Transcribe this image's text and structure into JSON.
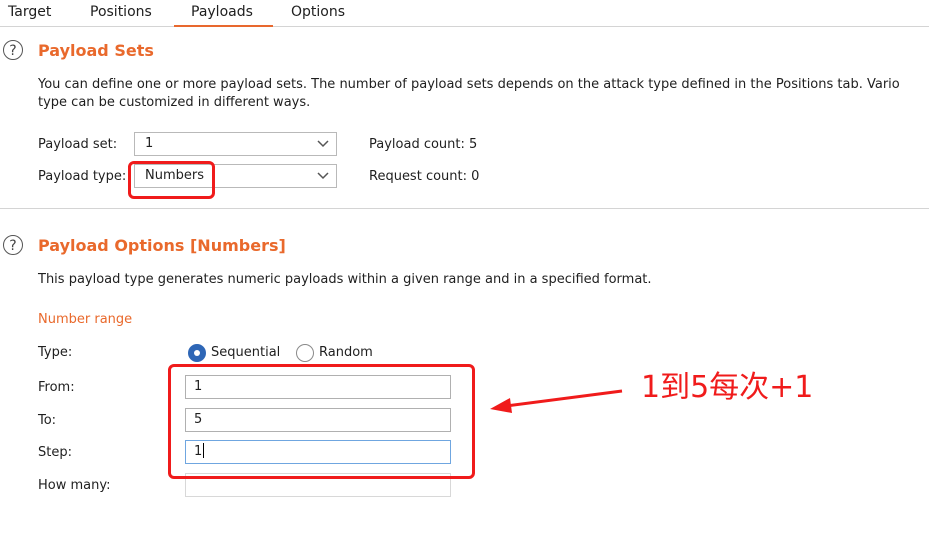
{
  "tabs": [
    {
      "label": "Target",
      "active": false
    },
    {
      "label": "Positions",
      "active": false
    },
    {
      "label": "Payloads",
      "active": true
    },
    {
      "label": "Options",
      "active": false
    }
  ],
  "accent_color": "#e9692c",
  "annotation_color": "#f01b1b",
  "payload_sets": {
    "help_glyph": "?",
    "title": "Payload Sets",
    "desc_line1": "You can define one or more payload sets. The number of payload sets depends on the attack type defined in the Positions tab. Vario",
    "desc_line2": "type can be customized in different ways.",
    "set_label": "Payload set:",
    "set_value": "1",
    "type_label": "Payload type:",
    "type_value": "Numbers",
    "count_label": "Payload count: 5",
    "request_label": "Request count: 0"
  },
  "payload_options": {
    "help_glyph": "?",
    "title": "Payload Options [Numbers]",
    "desc": "This payload type generates numeric payloads within a given range and in a specified format.",
    "range_heading": "Number range",
    "type_label": "Type:",
    "radio_sequential": "Sequential",
    "radio_random": "Random",
    "selected_type": "Sequential",
    "from_label": "From:",
    "from_value": "1",
    "to_label": "To:",
    "to_value": "5",
    "step_label": "Step:",
    "step_value": "1",
    "howmany_label": "How many:",
    "howmany_value": ""
  },
  "annotation": {
    "text": "1到5每次+1"
  }
}
